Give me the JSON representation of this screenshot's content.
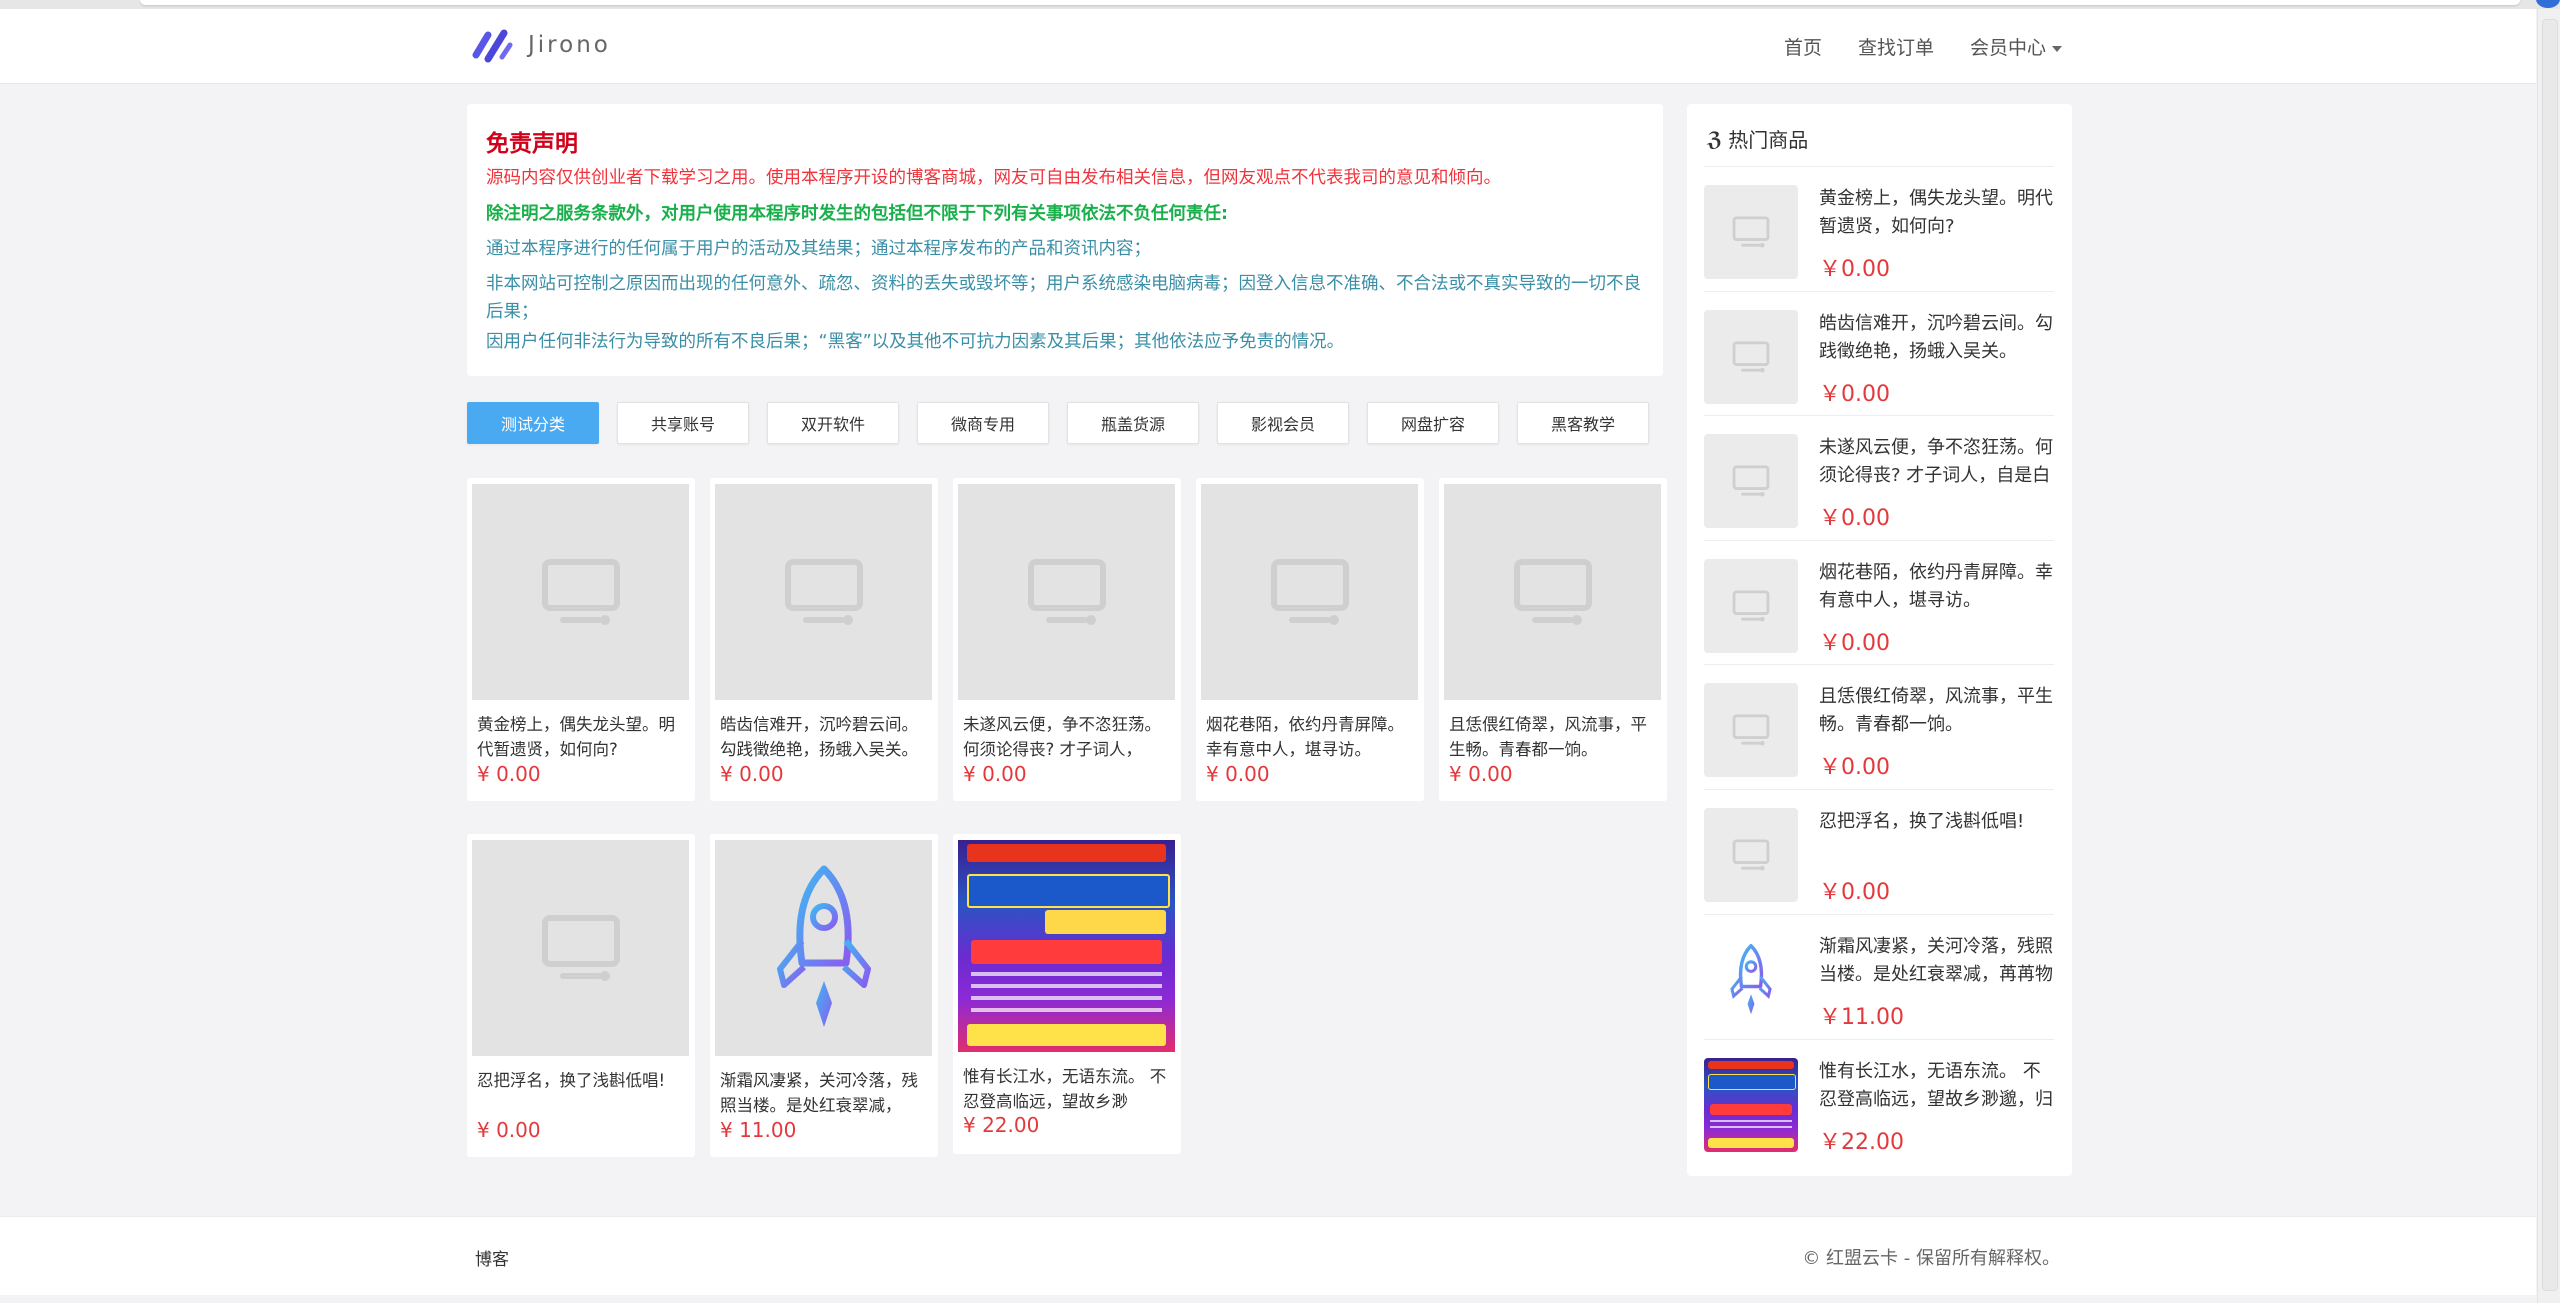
{
  "header": {
    "logo_text": "Jirono",
    "nav": [
      {
        "label": "首页"
      },
      {
        "label": "查找订单"
      },
      {
        "label": "会员中心"
      }
    ]
  },
  "notice": {
    "title": "免责声明",
    "lines": [
      "源码内容仅供创业者下载学习之用。使用本程序开设的博客商城，网友可自由发布相关信息，但网友观点不代表我司的意见和倾向。",
      "除注明之服务条款外，对用户使用本程序时发生的包括但不限于下列有关事项依法不负任何责任:",
      "通过本程序进行的任何属于用户的活动及其结果；通过本程序发布的产品和资讯内容；",
      "非本网站可控制之原因而出现的任何意外、疏忽、资料的丢失或毁坏等；用户系统感染电脑病毒；因登入信息不准确、不合法或不真实导致的一切不良后果；",
      "因用户任何非法行为导致的所有不良后果；“黑客”以及其他不可抗力因素及其后果；其他依法应予免责的情况。"
    ]
  },
  "categories": [
    {
      "label": "测试分类",
      "active": true
    },
    {
      "label": "共享账号"
    },
    {
      "label": "双开软件"
    },
    {
      "label": "微商专用"
    },
    {
      "label": "瓶盖货源"
    },
    {
      "label": "影视会员"
    },
    {
      "label": "网盘扩容"
    },
    {
      "label": "黑客教学"
    }
  ],
  "products": [
    {
      "name": "黄金榜上，偶失龙头望。明代暂遗贤，如何向?",
      "price": "¥ 0.00",
      "image": "placeholder"
    },
    {
      "name": "皓齿信难开，沉吟碧云间。勾践徵绝艳，扬蛾入吴关。",
      "price": "¥ 0.00",
      "image": "placeholder"
    },
    {
      "name": "未遂风云便，争不恣狂荡。何须论得丧? 才子词人，自...",
      "price": "¥ 0.00",
      "image": "placeholder"
    },
    {
      "name": "烟花巷陌，依约丹青屏障。幸有意中人，堪寻访。",
      "price": "¥ 0.00",
      "image": "placeholder"
    },
    {
      "name": "且恁偎红倚翠，风流事，平生畅。青春都一饷。",
      "price": "¥ 0.00",
      "image": "placeholder"
    },
    {
      "name": "忍把浮名，换了浅斟低唱!",
      "price": "¥ 0.00",
      "image": "placeholder"
    },
    {
      "name": "渐霜风凄紧，关河冷落，残照当楼。是处红衰翠减，苒...",
      "price": "¥ 11.00",
      "image": "rocket"
    },
    {
      "name": "惟有长江水，无语东流。 不忍登高临远，望故乡渺邈，...",
      "price": "¥ 22.00",
      "image": "promo"
    }
  ],
  "sidebar": {
    "title": "热门商品",
    "items": [
      {
        "name": "黄金榜上，偶失龙头望。明代暂遗贤，如何向?",
        "price": "￥0.00",
        "image": "placeholder"
      },
      {
        "name": "皓齿信难开，沉吟碧云间。勾践徵绝艳，扬蛾入吴关。",
        "price": "￥0.00",
        "image": "placeholder"
      },
      {
        "name": "未遂风云便，争不恣狂荡。何须论得丧? 才子词人，自是白",
        "price": "￥0.00",
        "image": "placeholder"
      },
      {
        "name": "烟花巷陌，依约丹青屏障。幸有意中人，堪寻访。",
        "price": "￥0.00",
        "image": "placeholder"
      },
      {
        "name": "且恁偎红倚翠，风流事，平生畅。青春都一饷。",
        "price": "￥0.00",
        "image": "placeholder"
      },
      {
        "name": "忍把浮名，换了浅斟低唱!",
        "price": "￥0.00",
        "image": "placeholder"
      },
      {
        "name": "渐霜风凄紧，关河冷落，残照当楼。是处红衰翠减，苒苒物",
        "price": "￥11.00",
        "image": "rocket"
      },
      {
        "name": "惟有长江水，无语东流。 不忍登高临远，望故乡渺邈，归思",
        "price": "￥22.00",
        "image": "promo"
      }
    ]
  },
  "footer": {
    "left": "博客",
    "right": "© 红盟云卡 - 保留所有解释权。"
  },
  "colors": {
    "accent": "#49aaf2",
    "price": "#e4393c",
    "notice_title": "#d0021b",
    "notice_red": "#f0333b",
    "notice_green": "#19b04b",
    "notice_teal": "#3a8fa6"
  }
}
